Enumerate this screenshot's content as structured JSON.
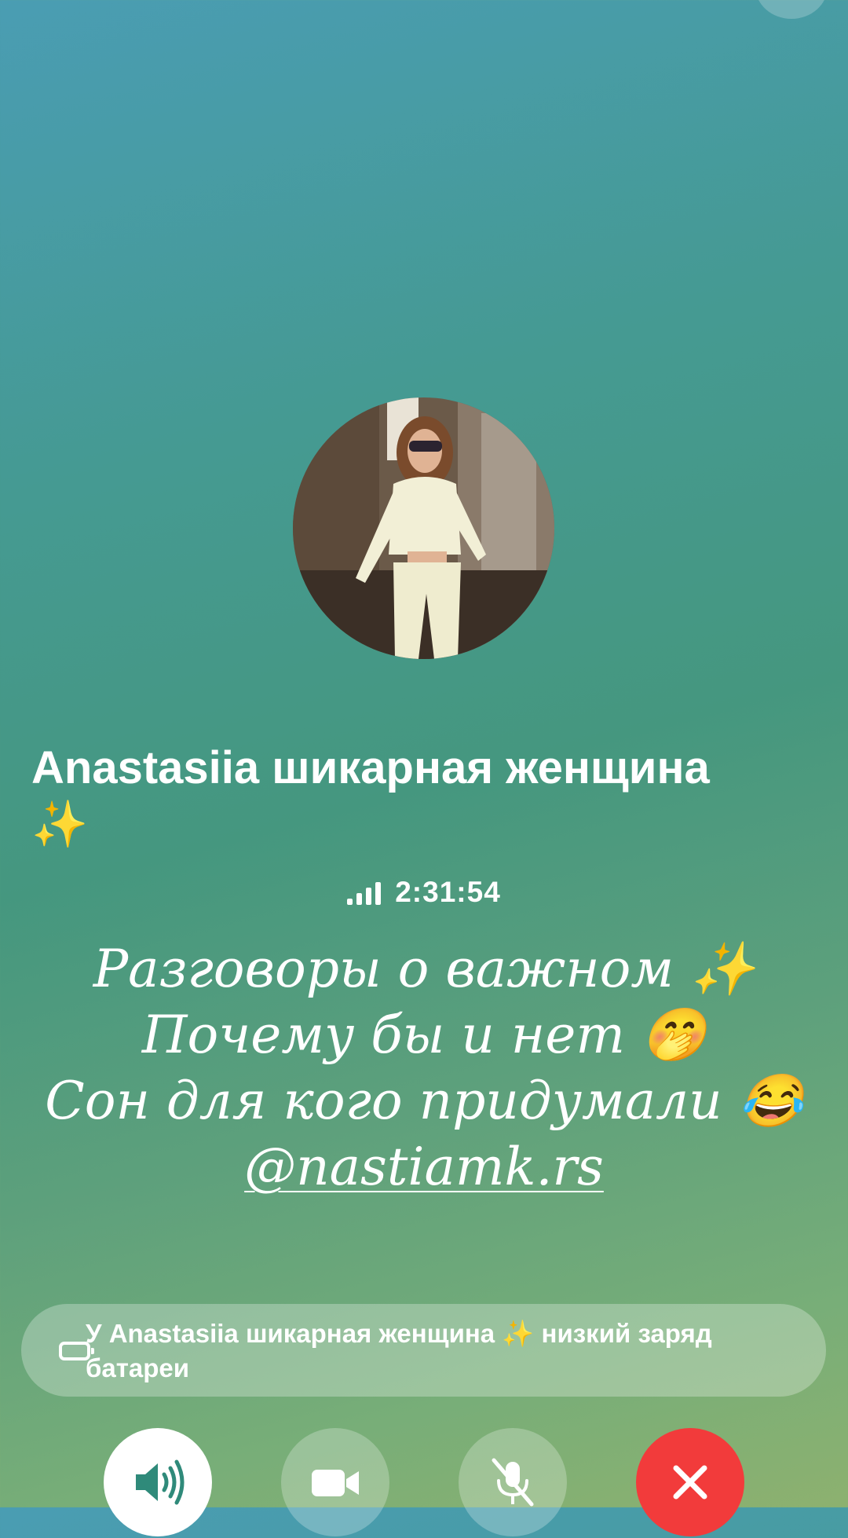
{
  "contact": {
    "name": "Anastasiia шикарная женщина",
    "name_emoji": "✨"
  },
  "call": {
    "duration": "2:31:54",
    "signal_bars": 4
  },
  "bio": {
    "line1": "Разговоры о важном ✨",
    "line2": "Почему бы и нет 🤭",
    "line3": "Сон для кого придумали 😂",
    "link": "@nastiamk.rs"
  },
  "notice": {
    "text": "У Anastasiia шикарная женщина ✨  низкий заряд батареи"
  },
  "controls": {
    "speaker_icon": "speaker-icon",
    "video_icon": "video-camera-icon",
    "mute_icon": "microphone-muted-icon",
    "end_icon": "close-icon",
    "end_color": "#f23b3b"
  }
}
